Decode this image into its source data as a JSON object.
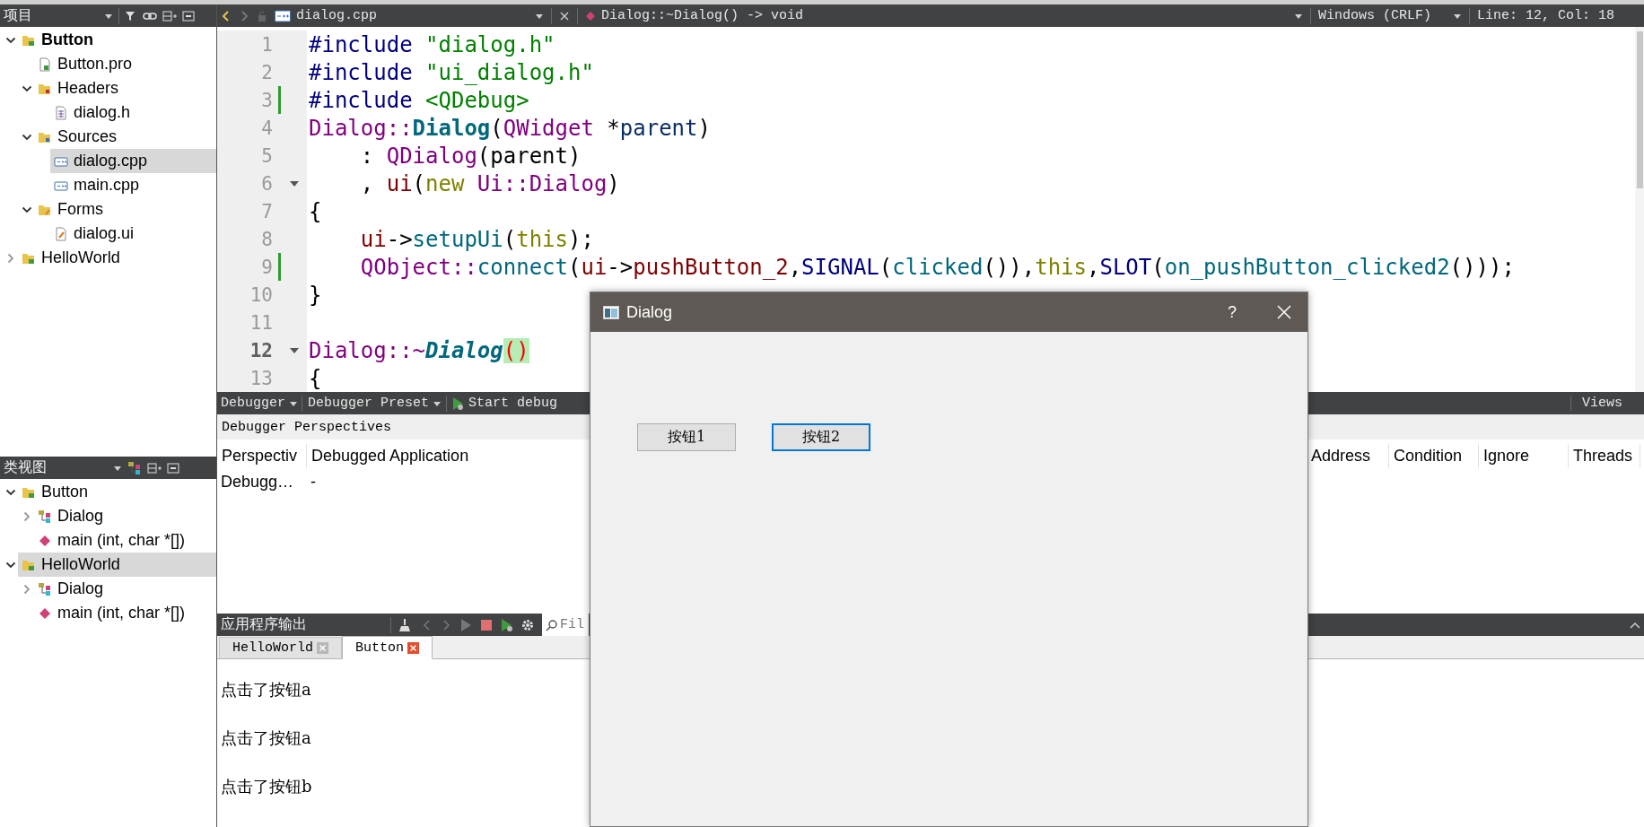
{
  "project_pane": {
    "title": "项目",
    "tree": [
      {
        "label": "Button",
        "kind": "project",
        "active": true,
        "selected": false,
        "expanded": true,
        "children": [
          {
            "label": "Button.pro",
            "kind": "pro",
            "selected": false
          },
          {
            "label": "Headers",
            "kind": "headers",
            "selected": false,
            "expanded": true,
            "children": [
              {
                "label": "dialog.h",
                "kind": "header",
                "selected": false
              }
            ]
          },
          {
            "label": "Sources",
            "kind": "sources",
            "selected": false,
            "expanded": true,
            "children": [
              {
                "label": "dialog.cpp",
                "kind": "cpp",
                "selected": true
              },
              {
                "label": "main.cpp",
                "kind": "cpp",
                "selected": false
              }
            ]
          },
          {
            "label": "Forms",
            "kind": "forms",
            "selected": false,
            "expanded": true,
            "children": [
              {
                "label": "dialog.ui",
                "kind": "ui",
                "selected": false
              }
            ]
          }
        ]
      },
      {
        "label": "HelloWorld",
        "kind": "project",
        "active": false,
        "selected": false,
        "expanded": false
      }
    ]
  },
  "editor": {
    "file": "dialog.cpp",
    "symbol": "Dialog::~Dialog() -> void",
    "line_ending": "Windows (CRLF)",
    "position": "Line: 12, Col: 18",
    "lines": [
      {
        "number": "1",
        "current": false,
        "fold": false,
        "changed": false,
        "segments": [
          {
            "text": "#include ",
            "kind": "pre"
          },
          {
            "text": "\"dialog.h\"",
            "kind": "str"
          }
        ]
      },
      {
        "number": "2",
        "current": false,
        "fold": false,
        "changed": false,
        "segments": [
          {
            "text": "#include ",
            "kind": "pre"
          },
          {
            "text": "\"ui_dialog.h\"",
            "kind": "str"
          }
        ]
      },
      {
        "number": "3",
        "current": false,
        "fold": false,
        "changed": true,
        "segments": [
          {
            "text": "#include ",
            "kind": "pre"
          },
          {
            "text": "<QDebug>",
            "kind": "str"
          }
        ]
      },
      {
        "number": "4",
        "current": false,
        "fold": false,
        "changed": false,
        "segments": [
          {
            "text": "Dialog::",
            "kind": "type"
          },
          {
            "text": "Dialog",
            "kind": "decl"
          },
          {
            "text": "(",
            "kind": "plain"
          },
          {
            "text": "QWidget",
            "kind": "type"
          },
          {
            "text": " *",
            "kind": "plain"
          },
          {
            "text": "parent",
            "kind": "param"
          },
          {
            "text": ")",
            "kind": "plain"
          }
        ]
      },
      {
        "number": "5",
        "current": false,
        "fold": false,
        "changed": false,
        "segments": [
          {
            "text": "    : ",
            "kind": "plain"
          },
          {
            "text": "QDialog",
            "kind": "type"
          },
          {
            "text": "(parent)",
            "kind": "plain"
          }
        ]
      },
      {
        "number": "6",
        "current": false,
        "fold": true,
        "changed": false,
        "segments": [
          {
            "text": "    , ",
            "kind": "plain"
          },
          {
            "text": "ui",
            "kind": "member"
          },
          {
            "text": "(",
            "kind": "plain"
          },
          {
            "text": "new ",
            "kind": "kw"
          },
          {
            "text": "Ui::Dialog",
            "kind": "type"
          },
          {
            "text": ")",
            "kind": "plain"
          }
        ]
      },
      {
        "number": "7",
        "current": false,
        "fold": false,
        "changed": false,
        "segments": [
          {
            "text": "{",
            "kind": "plain"
          }
        ]
      },
      {
        "number": "8",
        "current": false,
        "fold": false,
        "changed": false,
        "segments": [
          {
            "text": "    ui",
            "kind": "member"
          },
          {
            "text": "->",
            "kind": "plain"
          },
          {
            "text": "setupUi",
            "kind": "func"
          },
          {
            "text": "(",
            "kind": "plain"
          },
          {
            "text": "this",
            "kind": "kw"
          },
          {
            "text": ");",
            "kind": "plain"
          }
        ]
      },
      {
        "number": "9",
        "current": false,
        "fold": false,
        "changed": true,
        "segments": [
          {
            "text": "    QObject::",
            "kind": "type"
          },
          {
            "text": "connect",
            "kind": "func"
          },
          {
            "text": "(",
            "kind": "plain"
          },
          {
            "text": "ui",
            "kind": "member"
          },
          {
            "text": "->",
            "kind": "plain"
          },
          {
            "text": "pushButton_2",
            "kind": "member"
          },
          {
            "text": ",",
            "kind": "plain"
          },
          {
            "text": "SIGNAL",
            "kind": "macro"
          },
          {
            "text": "(",
            "kind": "plain"
          },
          {
            "text": "clicked",
            "kind": "func"
          },
          {
            "text": "()),",
            "kind": "plain"
          },
          {
            "text": "this",
            "kind": "kw"
          },
          {
            "text": ",",
            "kind": "plain"
          },
          {
            "text": "SLOT",
            "kind": "macro"
          },
          {
            "text": "(",
            "kind": "plain"
          },
          {
            "text": "on_pushButton_clicked2",
            "kind": "func"
          },
          {
            "text": "()));",
            "kind": "plain"
          }
        ]
      },
      {
        "number": "10",
        "current": false,
        "fold": false,
        "changed": false,
        "segments": [
          {
            "text": "}",
            "kind": "plain"
          }
        ]
      },
      {
        "number": "11",
        "current": false,
        "fold": false,
        "changed": false
      },
      {
        "number": "12",
        "current": true,
        "fold": true,
        "changed": false,
        "segments": [
          {
            "text": "Dialog::~",
            "kind": "type"
          },
          {
            "text": "Dialog",
            "kind": "dtor"
          },
          {
            "text": "()",
            "kind": "match"
          }
        ]
      },
      {
        "number": "13",
        "current": false,
        "fold": false,
        "changed": false,
        "segments": [
          {
            "text": "{",
            "kind": "plain"
          }
        ]
      }
    ]
  },
  "class_pane": {
    "title": "类视图",
    "tree": [
      {
        "label": "Button",
        "kind": "project",
        "selected": false,
        "expanded": true,
        "children": [
          {
            "label": "Dialog",
            "kind": "class",
            "selected": false,
            "expanded": false
          },
          {
            "label": "main (int, char *[])",
            "kind": "function",
            "selected": false
          }
        ]
      },
      {
        "label": "HelloWorld",
        "kind": "project",
        "selected": true,
        "expanded": true,
        "children": [
          {
            "label": "Dialog",
            "kind": "class",
            "selected": false,
            "expanded": false
          },
          {
            "label": "main (int, char *[])",
            "kind": "function",
            "selected": false
          }
        ]
      }
    ]
  },
  "debugger": {
    "mode": "Debugger",
    "preset": "Debugger Preset",
    "start": "Start debug",
    "views": "Views",
    "perspectives_label": "Debugger Perspectives",
    "perspective_columns": [
      "Perspectiv",
      "Debugged Application"
    ],
    "perspective_rows": [
      [
        "Debugg…",
        "-"
      ]
    ],
    "breakpoint_columns": [
      "Address",
      "Condition",
      "Ignore",
      "Threads"
    ]
  },
  "output": {
    "title": "应用程序输出",
    "filter_placeholder": "Fil",
    "tabs": [
      {
        "label": "HelloWorld",
        "selected": false
      },
      {
        "label": "Button",
        "selected": true
      }
    ],
    "lines": [
      "点击了按钮a",
      "点击了按钮a",
      "点击了按钮b"
    ]
  },
  "dialog": {
    "title": "Dialog",
    "help": "?",
    "buttons": [
      {
        "label": "按钮1",
        "focused": false
      },
      {
        "label": "按钮2",
        "focused": true
      }
    ]
  }
}
